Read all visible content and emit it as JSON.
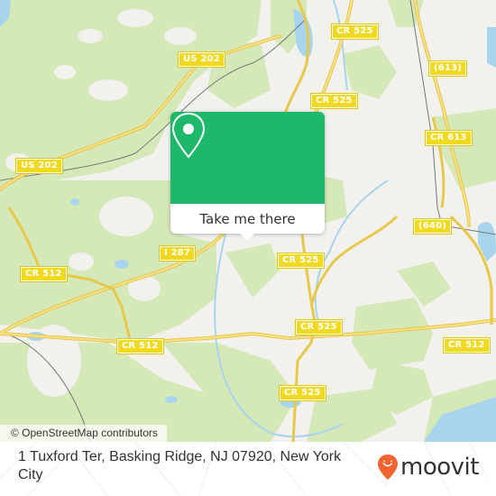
{
  "map": {
    "road_shields": [
      {
        "label": "US 202",
        "id": "us202-north"
      },
      {
        "label": "US 202",
        "id": "us202-west"
      },
      {
        "label": "CR 525",
        "id": "cr525-top"
      },
      {
        "label": "CR 525",
        "id": "cr525-mid-upper"
      },
      {
        "label": "(613)",
        "id": "613-top"
      },
      {
        "label": "CR 613",
        "id": "cr613"
      },
      {
        "label": "(640)",
        "id": "640"
      },
      {
        "label": "I 287",
        "id": "i287"
      },
      {
        "label": "CR 512",
        "id": "cr512-west"
      },
      {
        "label": "CR 525",
        "id": "cr525-center"
      },
      {
        "label": "CR 525",
        "id": "cr525-lower"
      },
      {
        "label": "CR 512",
        "id": "cr512-center"
      },
      {
        "label": "CR 512",
        "id": "cr512-east"
      },
      {
        "label": "CR 525",
        "id": "cr525-bottom"
      }
    ],
    "colors": {
      "land": "#f2f1ee",
      "forest": "#d5e8b7",
      "water": "#a9d4ee",
      "road": "#f4d35e",
      "rail": "#777777"
    },
    "attribution": "© OpenStreetMap contributors"
  },
  "popup": {
    "icon": "location-pin-icon",
    "button_label": "Take me there",
    "accent_color": "#1eb86a"
  },
  "footer": {
    "address": "1 Tuxford Ter, Basking Ridge, NJ 07920, New York City",
    "brand": "moovit",
    "brand_color": "#f26532"
  }
}
